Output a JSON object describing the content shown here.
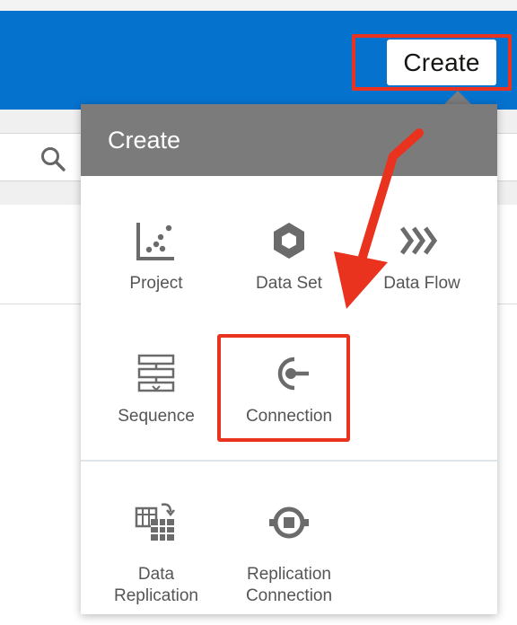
{
  "header": {
    "create_label": "Create"
  },
  "popup": {
    "title": "Create",
    "items": [
      {
        "label": "Project",
        "icon": "scatter-chart-icon"
      },
      {
        "label": "Data Set",
        "icon": "hexagon-icon"
      },
      {
        "label": "Data Flow",
        "icon": "chevrons-right-icon"
      },
      {
        "label": "Sequence",
        "icon": "sequence-icon"
      },
      {
        "label": "Connection",
        "icon": "connection-icon"
      }
    ],
    "replication_items": [
      {
        "label_line1": "Data",
        "label_line2": "Replication",
        "icon": "data-replication-icon"
      },
      {
        "label_line1": "Replication",
        "label_line2": "Connection",
        "icon": "replication-connection-icon"
      }
    ]
  },
  "colors": {
    "header_blue": "#0572ce",
    "highlight_red": "#e9331f",
    "popup_header_grey": "#7b7b7b",
    "icon_grey": "#6b6b6b"
  }
}
